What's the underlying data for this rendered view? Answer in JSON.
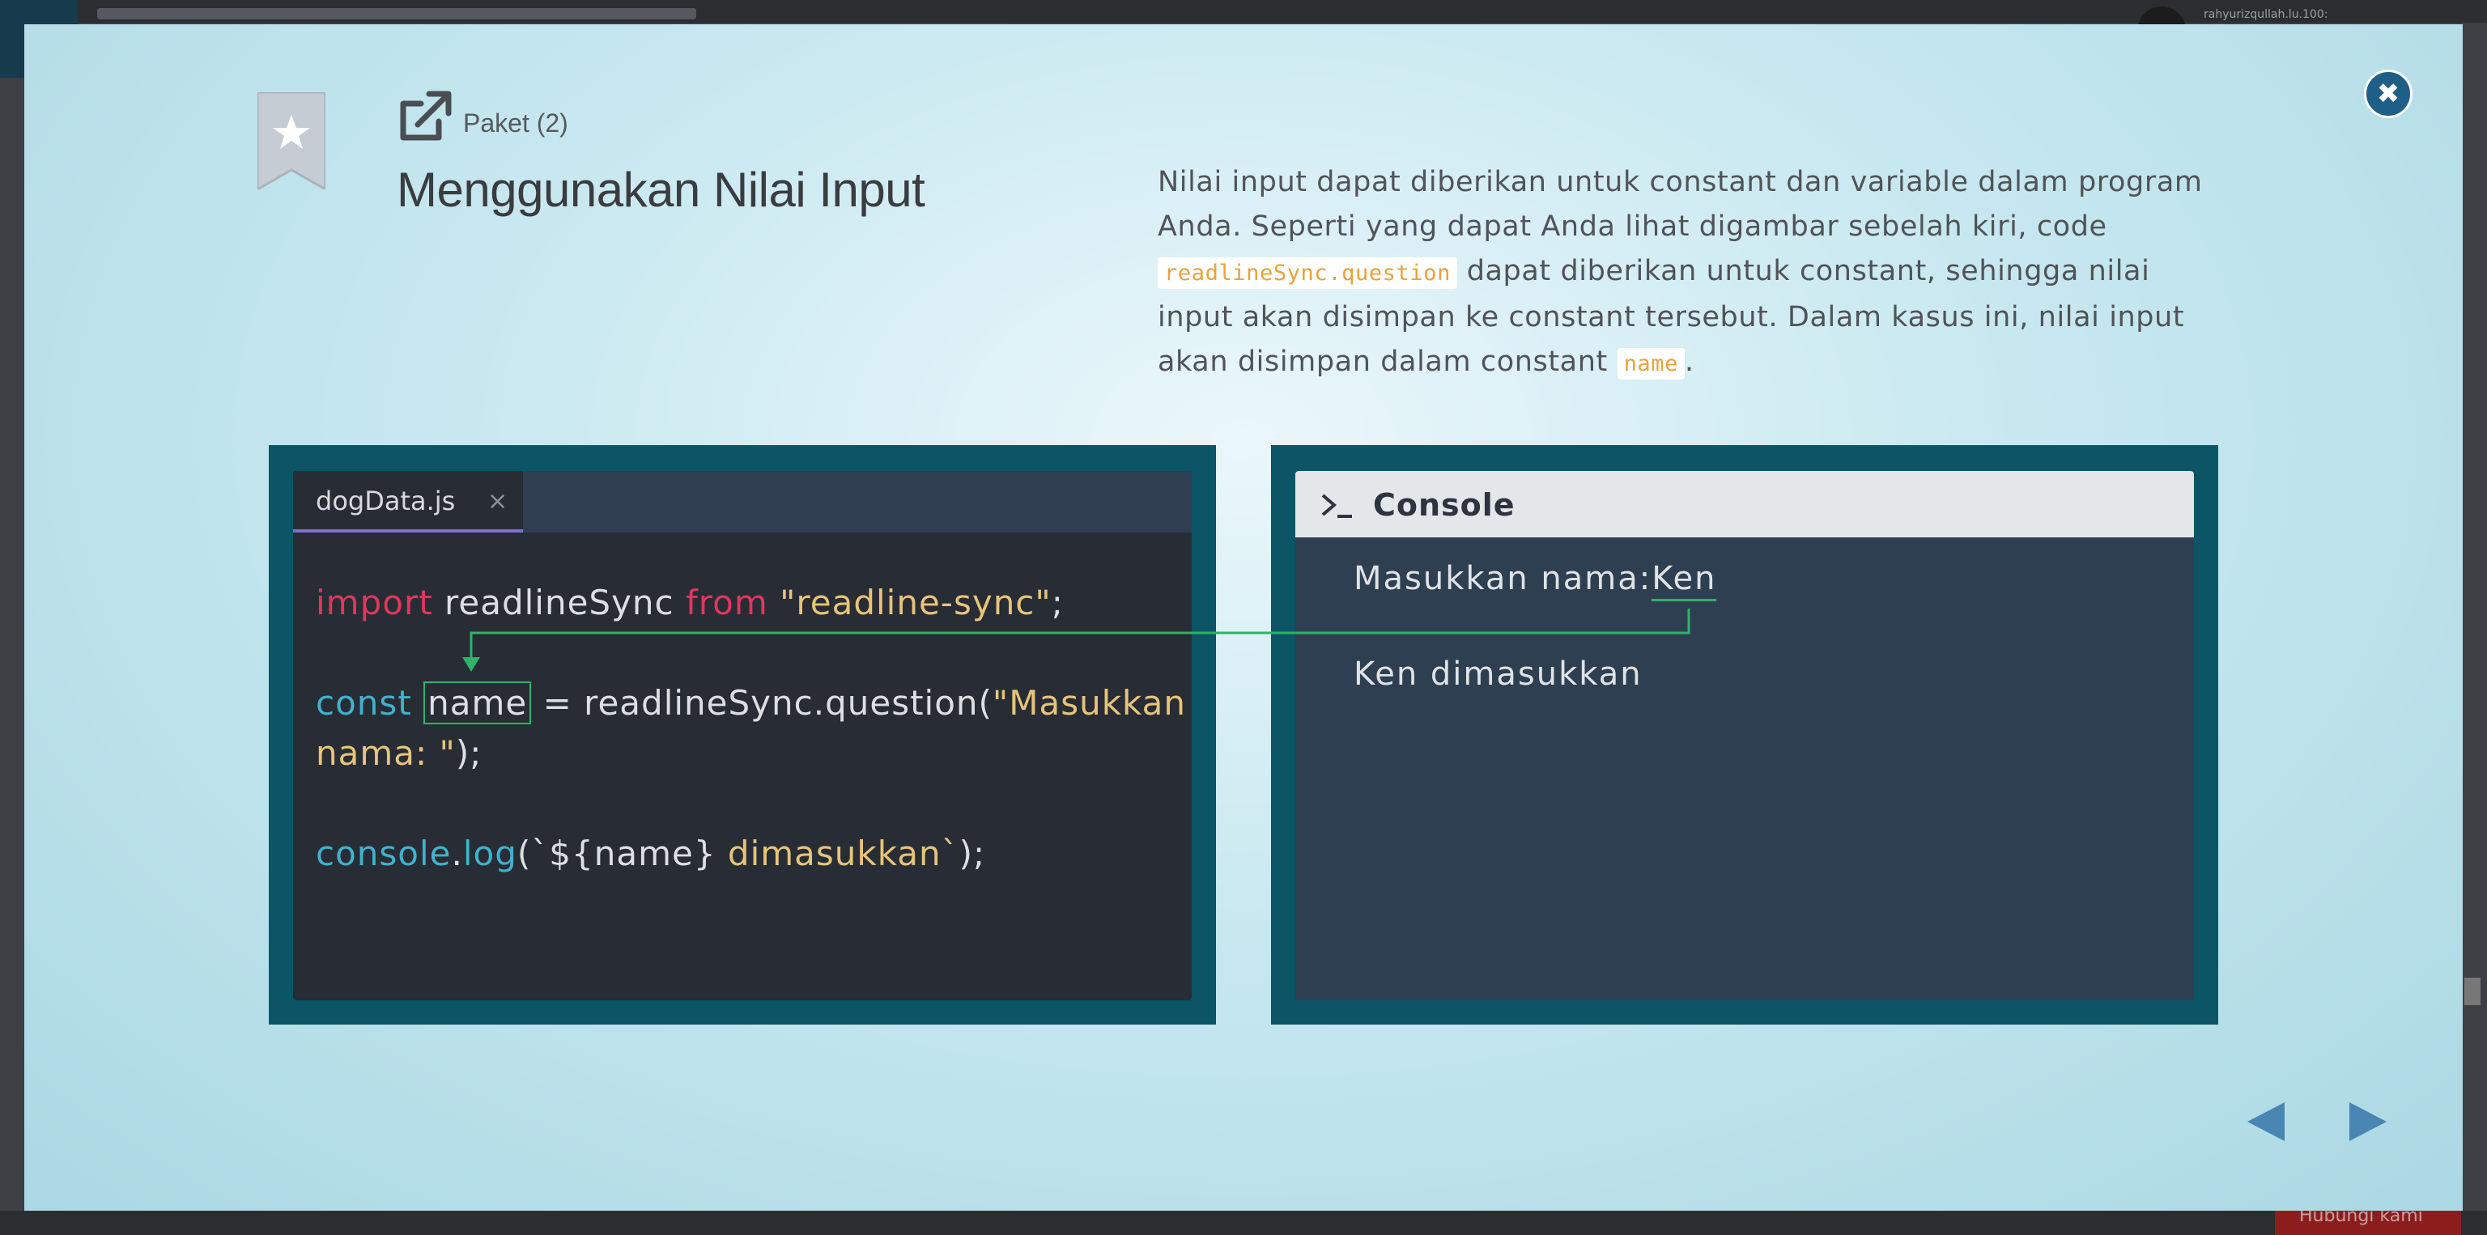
{
  "background_page": {
    "username": "rahyurizqullah.lu.100:",
    "button_label": "Hubungi kami"
  },
  "modal": {
    "subtitle": "Paket (2)",
    "title": "Menggunakan Nilai Input",
    "description": {
      "part1": "Nilai input dapat diberikan untuk constant dan variable dalam program Anda. Seperti yang dapat Anda lihat digambar sebelah kiri, code ",
      "code1": "readlineSync.question",
      "part2": " dapat diberikan untuk constant, sehingga nilai input akan disimpan ke constant tersebut. Dalam kasus ini, nilai input akan disimpan dalam constant ",
      "code2": "name",
      "part3": "."
    },
    "editor": {
      "tab_name": "dogData.js",
      "tab_close": "×",
      "line1": {
        "kw1": "import",
        "mid": " readlineSync ",
        "kw2": "from",
        "str": " \"readline-sync\"",
        "end": ";"
      },
      "line2": {
        "kw": "const",
        "var": "name",
        "mid": " = readlineSync.question(",
        "str": "\"Masukkan"
      },
      "line3": {
        "str": "nama: \"",
        "end": ");"
      },
      "line4": {
        "obj": "console",
        "dot": ".",
        "fn": "log",
        "open": "(`${name} ",
        "str": "dimasukkan`",
        "end": ");"
      }
    },
    "console": {
      "title": "Console",
      "prompt_text": "Masukkan nama:",
      "input_value": "Ken",
      "output": "Ken dimasukkan"
    },
    "icons": {
      "bookmark": "bookmark-star-icon",
      "external": "external-link-icon",
      "close": "close-icon",
      "prompt": "terminal-prompt-icon",
      "prev": "prev-triangle-icon",
      "next": "next-triangle-icon"
    },
    "colors": {
      "accent": "#1f5f87",
      "panel": "#0b5566",
      "keyword": "#e0365e",
      "string": "#e6c47a",
      "constant": "#3fb2cf",
      "highlight": "#2fb36a"
    }
  }
}
